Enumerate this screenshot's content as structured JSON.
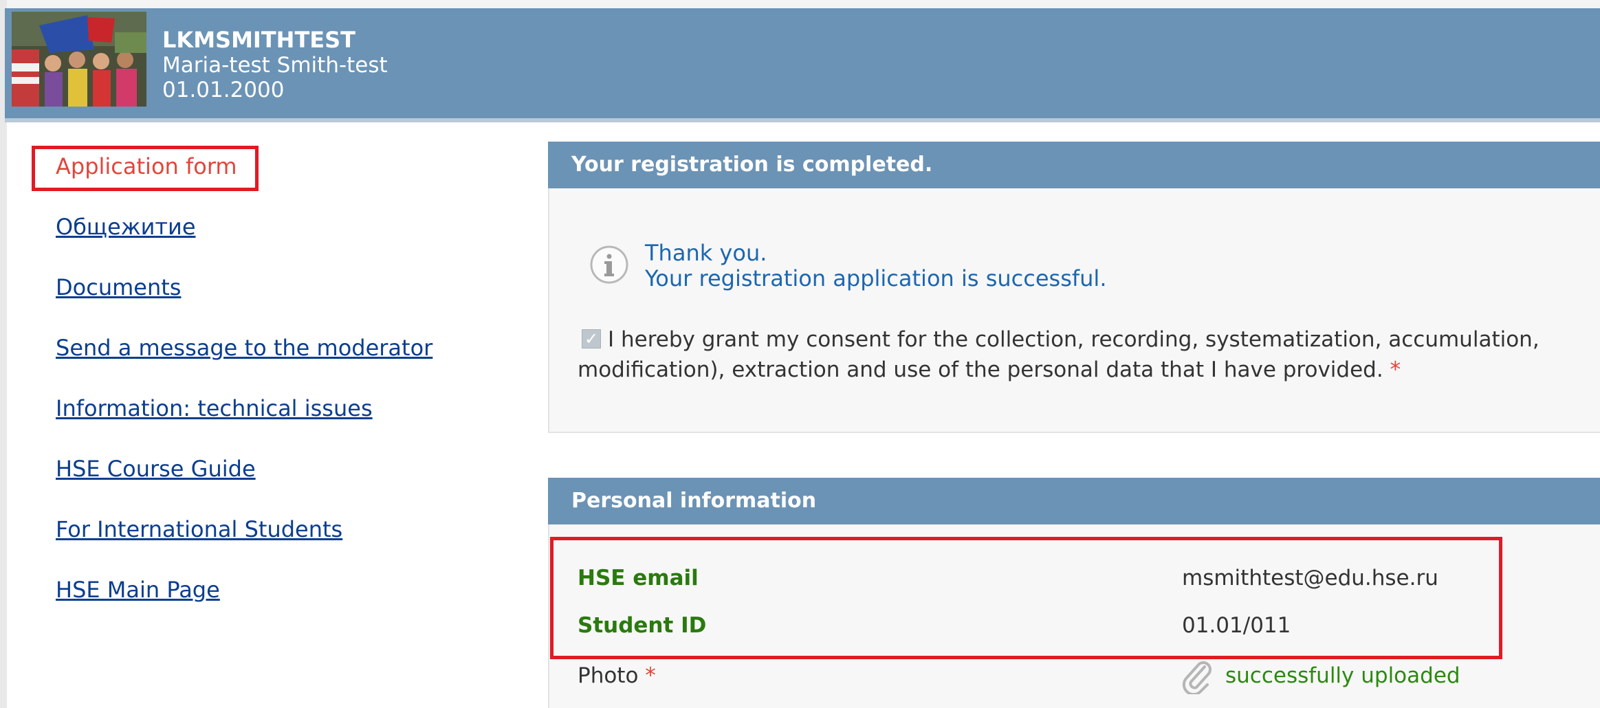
{
  "header": {
    "login": "LKMSMITHTEST",
    "full_name": "Maria-test Smith-test",
    "date_of_birth": "01.01.2000",
    "avatar_icon": "group-photo-avatar"
  },
  "sidebar": {
    "items": [
      {
        "label": "Application form",
        "active": true
      },
      {
        "label": "Общежитие"
      },
      {
        "label": "Documents"
      },
      {
        "label": "Send a message to the moderator"
      },
      {
        "label": "Information: technical issues"
      },
      {
        "label": "HSE Course Guide"
      },
      {
        "label": "For International Students"
      },
      {
        "label": "HSE Main Page"
      }
    ]
  },
  "registration": {
    "title": "Your registration is completed.",
    "info_icon": "info-icon",
    "thanks": "Thank you.",
    "message": "Your registration application is successful.",
    "consent_line1": "I hereby grant my consent for the collection, recording, systematization, accumulation,",
    "consent_line2": "modification), extraction and use of the personal data that I have provided.",
    "required_mark": "*"
  },
  "personal": {
    "title": "Personal information",
    "email_label": "HSE email",
    "email_value": "msmithtest@edu.hse.ru",
    "student_id_label": "Student ID",
    "student_id_value": "01.01/011",
    "photo_label": "Photo",
    "photo_status": "successfully uploaded",
    "photo_icon": "paperclip-icon"
  },
  "colors": {
    "header_bg": "#6b93b5",
    "link": "#0b3e8f",
    "active": "#e2453a",
    "highlight": "#e11a24",
    "label_green": "#2a7a0e"
  }
}
